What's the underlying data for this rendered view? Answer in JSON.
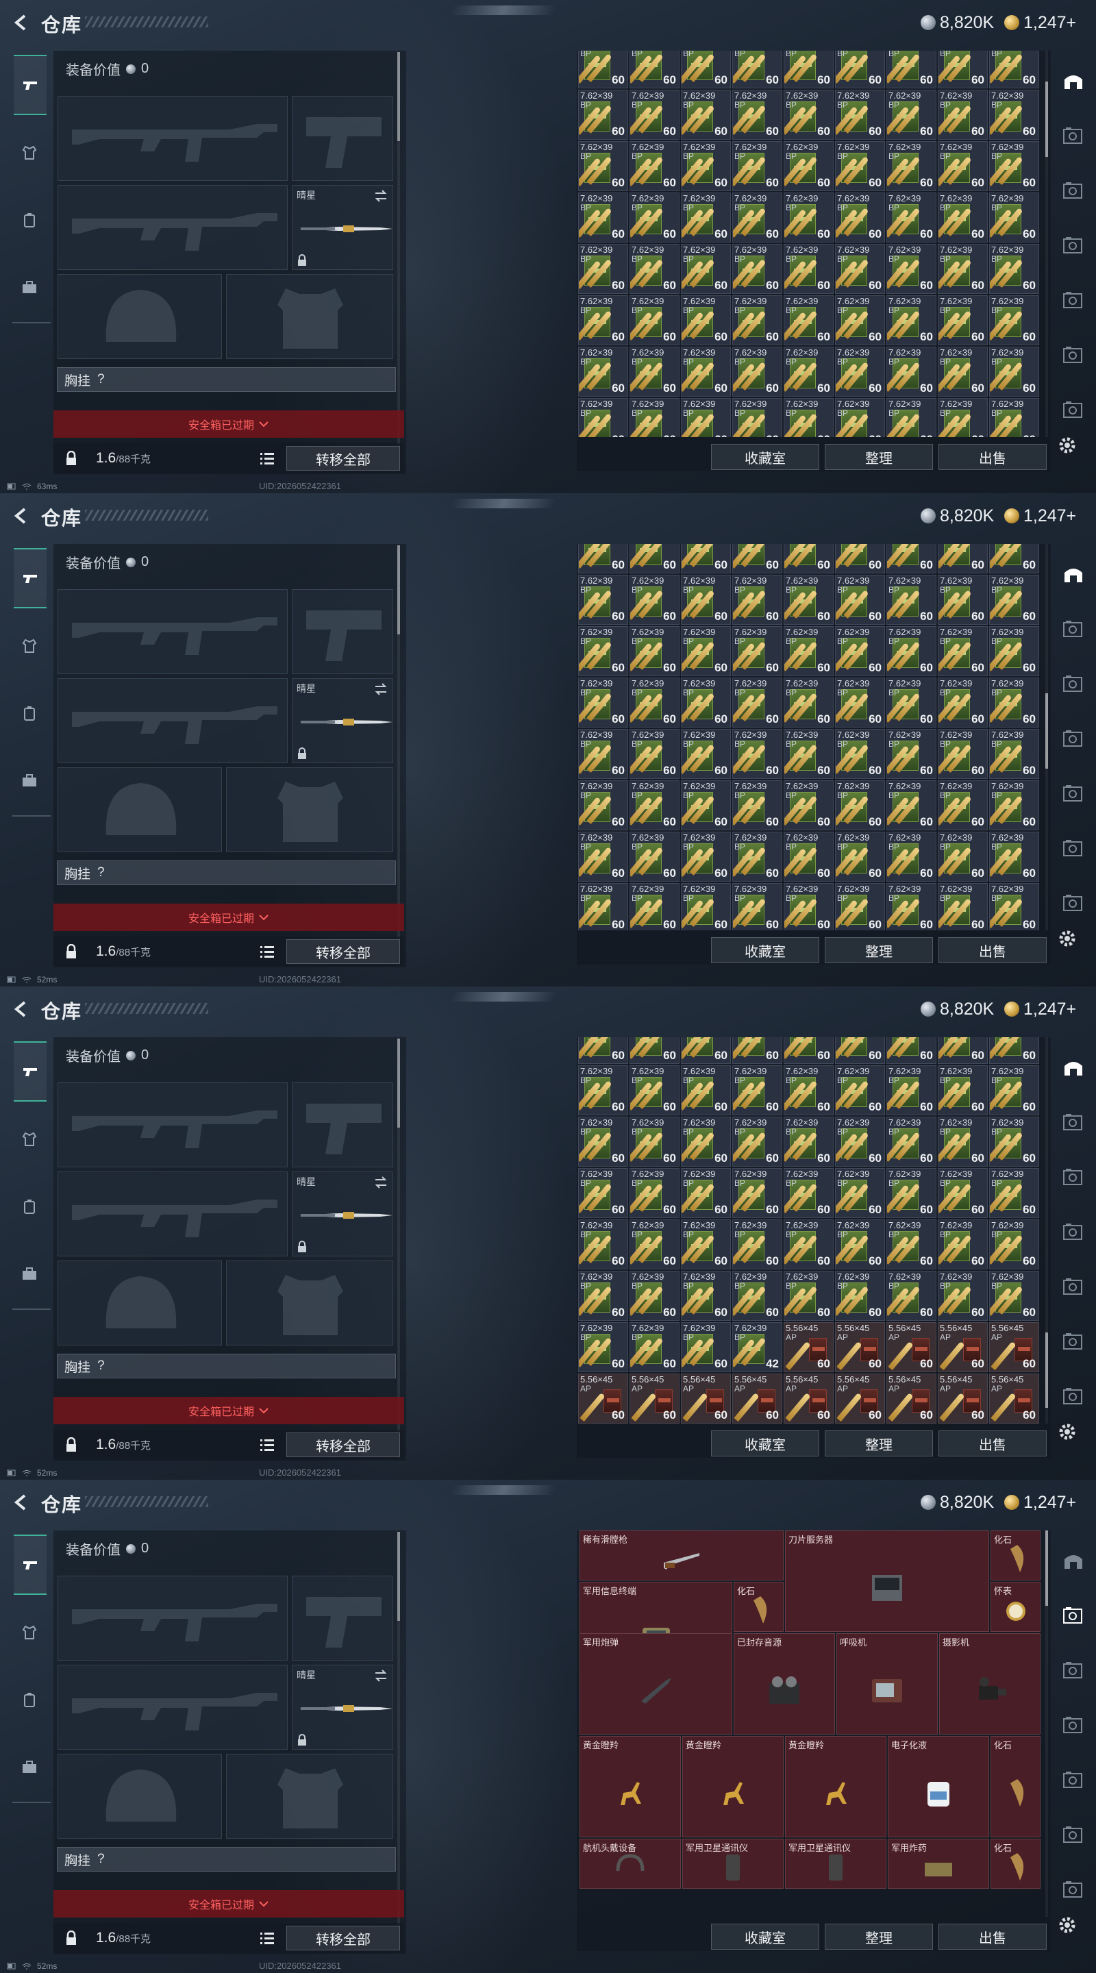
{
  "header": {
    "title": "仓库",
    "currency_silver": "8,820K",
    "currency_gold": "1,247+"
  },
  "loadout": {
    "equip_value_label": "装备价值",
    "equip_value": "0",
    "melee_slot_name": "晴星",
    "chest_rig_label": "胸挂",
    "chest_rig_value": "?",
    "safebox_text": "安全箱已过期",
    "weight_value": "1.6",
    "weight_capacity": "/88千克",
    "transfer_all_label": "转移全部"
  },
  "stash": {
    "ammo_762_name": "7.62×39",
    "ammo_762_sub": "BP",
    "ammo_556_name": "5.56×45",
    "ammo_556_sub": "AP",
    "qty_60": "60",
    "qty_42": "42",
    "collection_button": "收藏室",
    "sort_button": "整理",
    "sell_button": "出售",
    "frame3_partial_stack_qty": 42,
    "frame_scroll_positions": [
      0.1,
      0.48,
      0.95,
      0.0
    ]
  },
  "collectibles": [
    {
      "name": "稀有滑膛枪",
      "icon": "musket"
    },
    {
      "name": "刀片服务器",
      "icon": "blade-server"
    },
    {
      "name": "化石",
      "icon": "fossil-claw"
    },
    {
      "name": "军用信息终端",
      "icon": "rugged-terminal"
    },
    {
      "name": "化石",
      "icon": "fossil-claw"
    },
    {
      "name": "怀表",
      "icon": "pocket-watch"
    },
    {
      "name": "军用炮弹",
      "icon": "artillery-shell"
    },
    {
      "name": "已封存音源",
      "icon": "reel-recorder"
    },
    {
      "name": "呼吸机",
      "icon": "ventilator"
    },
    {
      "name": "摄影机",
      "icon": "movie-camera"
    },
    {
      "name": "黄金瞪羚",
      "icon": "gold-gazelle"
    },
    {
      "name": "黄金瞪羚",
      "icon": "gold-gazelle"
    },
    {
      "name": "黄金瞪羚",
      "icon": "gold-gazelle"
    },
    {
      "name": "电子化液",
      "icon": "liquid-jug"
    },
    {
      "name": "化石",
      "icon": "fossil-claw"
    },
    {
      "name": "航机头戴设备",
      "icon": "headset"
    },
    {
      "name": "军用卫星通讯仪",
      "icon": "sat-phone"
    },
    {
      "name": "军用卫星通讯仪",
      "icon": "sat-phone"
    },
    {
      "name": "军用炸药",
      "icon": "explosive"
    },
    {
      "name": "化石",
      "icon": "fossil-claw"
    }
  ],
  "status": {
    "ping_frames": [
      "63ms",
      "52ms",
      "52ms",
      "52ms"
    ],
    "uid": "UID:2026052422361"
  },
  "colors": {
    "accent": "#3fb39a",
    "danger": "#ff6161",
    "collectible_bg": "#4a1e26"
  }
}
